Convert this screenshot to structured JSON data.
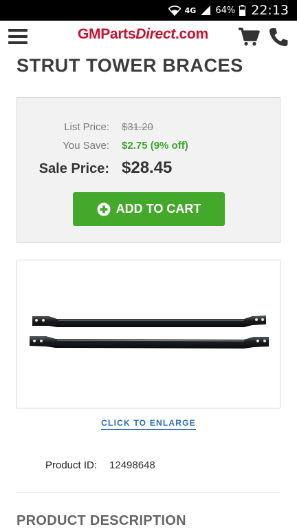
{
  "status_bar": {
    "network": "4G",
    "battery_percent": "64%",
    "time": "22:13",
    "icons": [
      "wifi-icon",
      "signal-icon",
      "battery-icon"
    ]
  },
  "header": {
    "logo_main": "GMParts",
    "logo_italic": "Direct",
    "logo_suffix": ".com",
    "icons": [
      "menu-icon",
      "cart-icon",
      "phone-icon"
    ],
    "brand_color": "#c8102e"
  },
  "product": {
    "title": "STRUT TOWER BRACES",
    "list_price_label": "List Price:",
    "list_price": "$31.20",
    "you_save_label": "You Save:",
    "you_save": "$2.75 (9% off)",
    "sale_price_label": "Sale Price:",
    "sale_price": "$28.45",
    "add_to_cart_label": "ADD TO CART",
    "enlarge_label": "CLICK TO ENLARGE",
    "product_id_label": "Product ID:",
    "product_id": "12498648",
    "description_title": "PRODUCT DESCRIPTION"
  },
  "colors": {
    "accent_green": "#44a82a",
    "save_green": "#3aa52c",
    "link_blue": "#2a6fb5"
  }
}
